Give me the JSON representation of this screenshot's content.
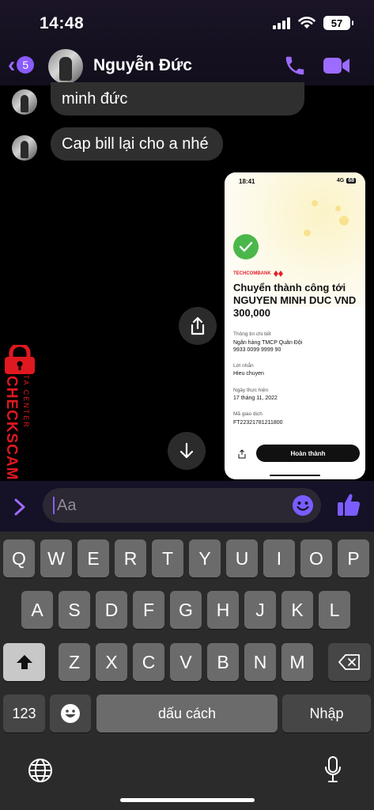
{
  "status_bar": {
    "time": "14:48",
    "battery": "57"
  },
  "header": {
    "back_badge": "5",
    "contact_name": "Nguyễn Đức"
  },
  "messages": [
    {
      "text": "minh đức"
    },
    {
      "text": "Cap bill lại cho a nhé"
    }
  ],
  "receipt": {
    "time": "18:41",
    "network": "4G",
    "battery": "68",
    "bank": "TECHCOMBANK",
    "title": "Chuyển thành công tới NGUYEN MINH DUC VND 300,000",
    "details_label": "Thông tin chi tiết",
    "bank_name": "Ngân hàng TMCP Quân Đội",
    "account": "9933 0099 9999 90",
    "message_label": "Lời nhắn",
    "message": "Hieu chuyen",
    "date_label": "Ngày thực hiện",
    "date": "17 tháng 11, 2022",
    "code_label": "Mã giao dịch",
    "code": "FT22321781211800",
    "done_button": "Hoàn thành"
  },
  "watermark": {
    "main": "CHECKSCAM.INFO",
    "sub": "DATA CENTER"
  },
  "composer": {
    "placeholder": "Aa"
  },
  "keyboard": {
    "row1": [
      "Q",
      "W",
      "E",
      "R",
      "T",
      "Y",
      "U",
      "I",
      "O",
      "P"
    ],
    "row2": [
      "A",
      "S",
      "D",
      "F",
      "G",
      "H",
      "J",
      "K",
      "L"
    ],
    "row3": [
      "Z",
      "X",
      "C",
      "V",
      "B",
      "N",
      "M"
    ],
    "numbers_key": "123",
    "space_key": "dấu cách",
    "return_key": "Nhập"
  },
  "colors": {
    "accent": "#8a5cff",
    "bubble": "#2f2f2f",
    "success": "#4bb74a",
    "watermark": "#e0181f"
  }
}
